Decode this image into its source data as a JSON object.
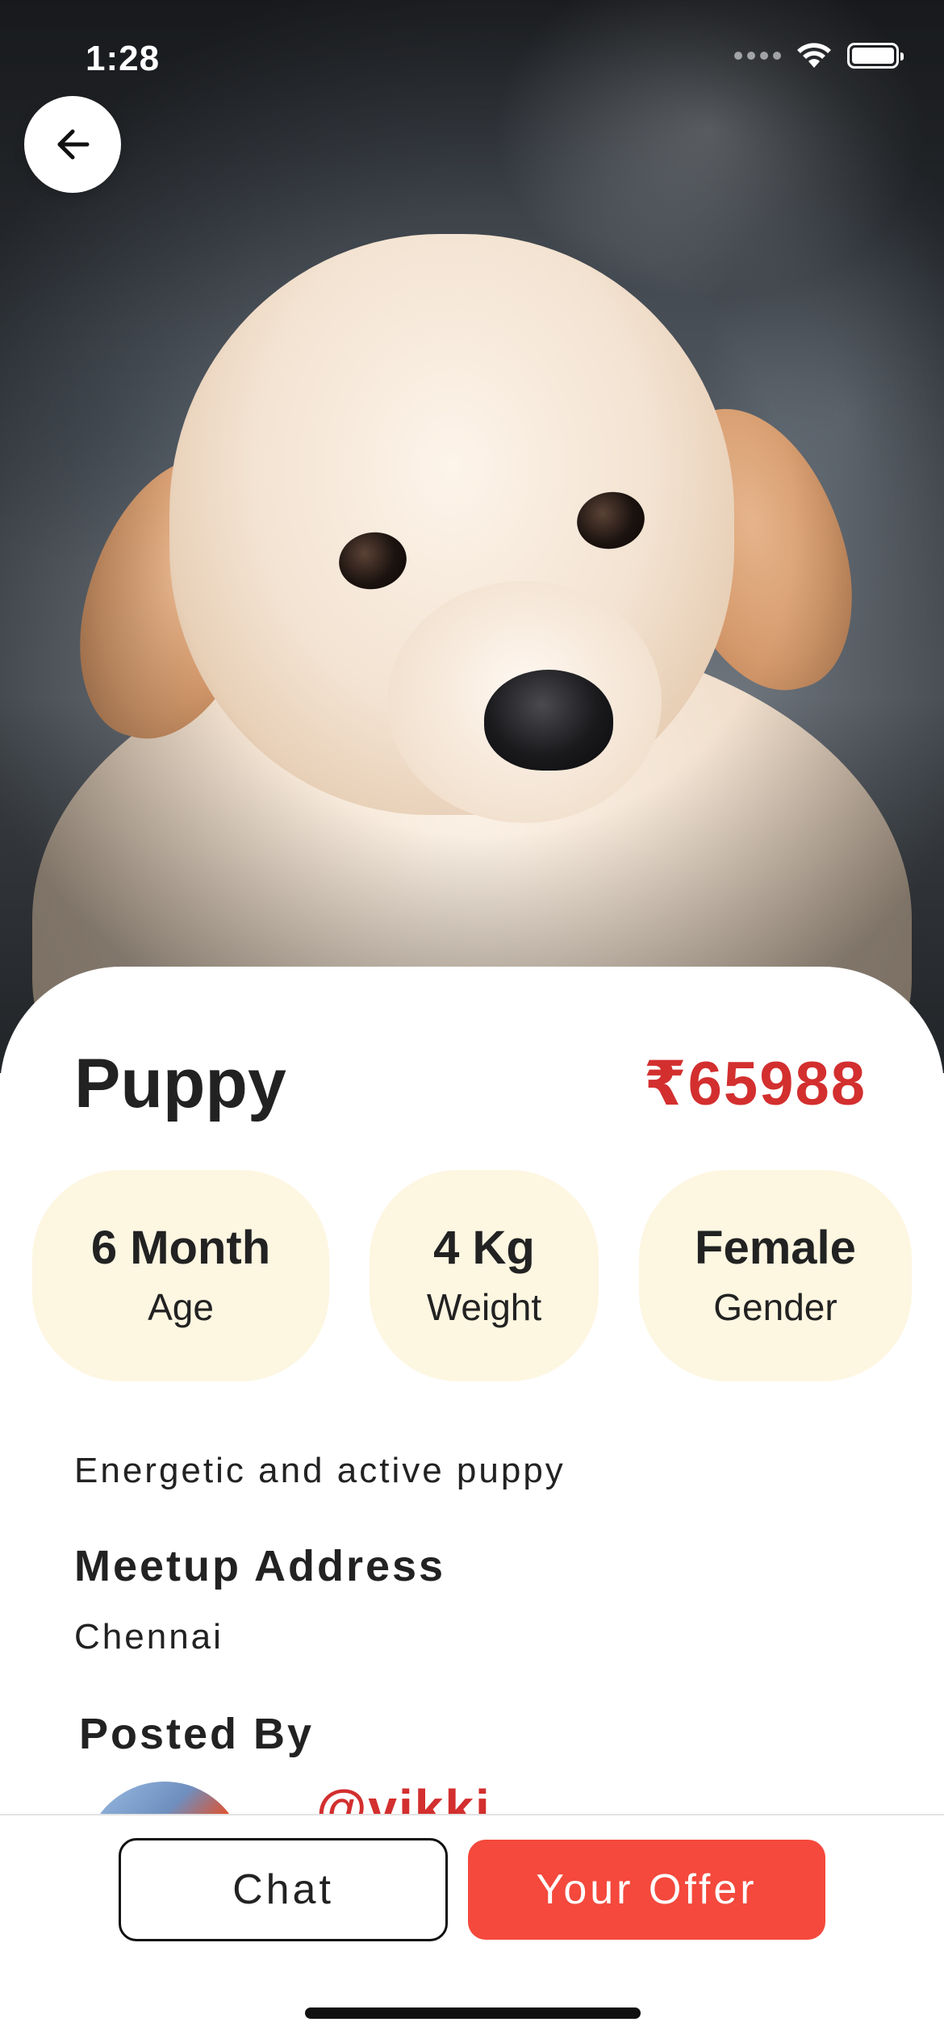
{
  "status_bar": {
    "time": "1:28",
    "icons": [
      "signal-icon",
      "wifi-icon",
      "battery-icon"
    ]
  },
  "navigation": {
    "back_icon": "arrow-left-icon"
  },
  "listing": {
    "name": "Puppy",
    "price": "₹65988",
    "stats": [
      {
        "value": "6 Month",
        "label": "Age"
      },
      {
        "value": "4 Kg",
        "label": "Weight"
      },
      {
        "value": "Female",
        "label": "Gender"
      }
    ],
    "description": "Energetic and active puppy",
    "meetup": {
      "heading": "Meetup Address",
      "value": "Chennai"
    },
    "posted_by": {
      "heading": "Posted By",
      "username": "@vikki"
    }
  },
  "actions": {
    "chat_label": "Chat",
    "offer_label": "Your Offer"
  },
  "colors": {
    "accent_red": "#d32f2f",
    "offer_button": "#f4493c",
    "chip_background": "#fdf6e1",
    "text_dark": "#222222"
  }
}
